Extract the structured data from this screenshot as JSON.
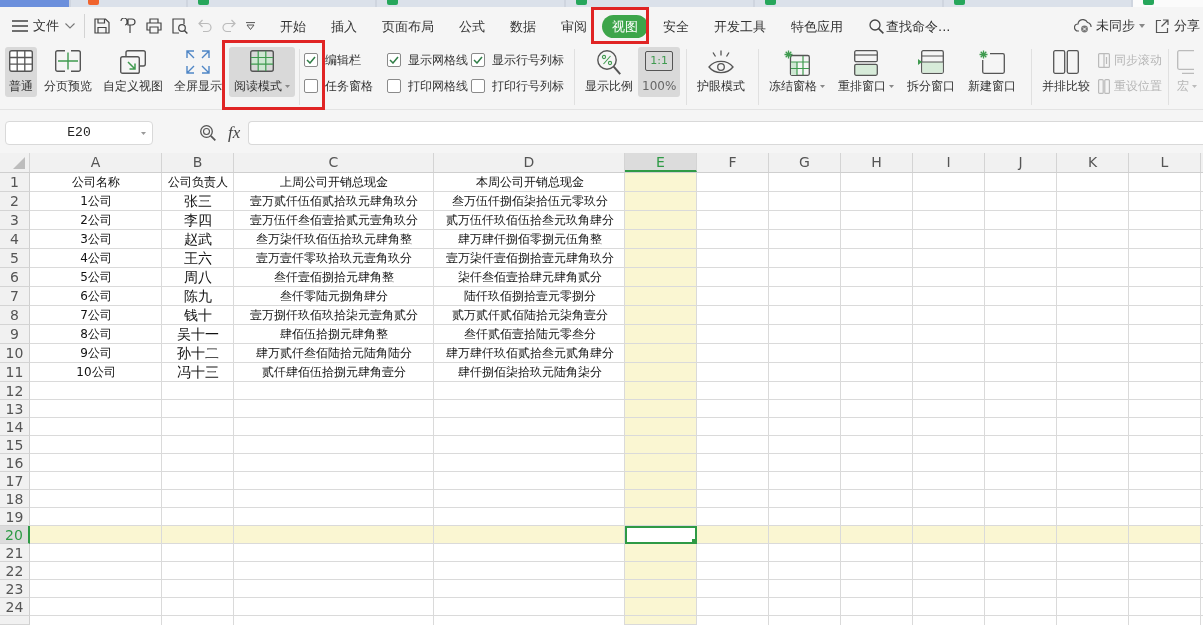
{
  "document_tabs": [
    {
      "selected": false,
      "color": "#f0642d"
    },
    {
      "selected": false,
      "color": "#26a65b"
    },
    {
      "selected": false,
      "color": "#26a65b"
    },
    {
      "selected": false,
      "color": "#26a65b"
    },
    {
      "selected": false,
      "color": "#26a65b"
    },
    {
      "selected": false,
      "color": "#26a65b"
    },
    {
      "selected": true,
      "color": "#26a65b"
    }
  ],
  "file_menu": {
    "label": "文件"
  },
  "menu_tabs": [
    {
      "label": "开始",
      "selected": false
    },
    {
      "label": "插入",
      "selected": false
    },
    {
      "label": "页面布局",
      "selected": false
    },
    {
      "label": "公式",
      "selected": false
    },
    {
      "label": "数据",
      "selected": false
    },
    {
      "label": "审阅",
      "selected": false
    },
    {
      "label": "视图",
      "selected": true
    },
    {
      "label": "安全",
      "selected": false
    },
    {
      "label": "开发工具",
      "selected": false
    },
    {
      "label": "特色应用",
      "selected": false
    }
  ],
  "command_search": {
    "placeholder": "查找命令..."
  },
  "sync_status": {
    "label": "未同步"
  },
  "share_button": {
    "label": "分享"
  },
  "ribbon": {
    "views": [
      {
        "label": "普通",
        "selected": true
      },
      {
        "label": "分页预览",
        "selected": false
      },
      {
        "label": "自定义视图",
        "selected": false
      },
      {
        "label": "全屏显示",
        "selected": false
      }
    ],
    "reading_mode": {
      "label": "阅读模式",
      "selected": true
    },
    "display_options": [
      {
        "label": "编辑栏",
        "checked": true
      },
      {
        "label": "任务窗格",
        "checked": false
      },
      {
        "label": "显示网格线",
        "checked": true
      },
      {
        "label": "打印网格线",
        "checked": false
      },
      {
        "label": "显示行号列标",
        "checked": true
      },
      {
        "label": "打印行号列标",
        "checked": false
      }
    ],
    "zoom": {
      "label": "显示比例"
    },
    "actual_size": {
      "label": "100%",
      "icon_text": "1:1",
      "selected": true
    },
    "eye_protection": {
      "label": "护眼模式"
    },
    "window_tools": [
      {
        "label": "冻结窗格",
        "dropdown": true
      },
      {
        "label": "重排窗口",
        "dropdown": true
      },
      {
        "label": "拆分窗口",
        "dropdown": false
      },
      {
        "label": "新建窗口",
        "dropdown": false
      }
    ],
    "compare": {
      "label": "并排比较"
    },
    "scroll_tools": [
      {
        "label": "同步滚动",
        "disabled": true
      },
      {
        "label": "重设位置",
        "disabled": true
      }
    ],
    "macro": {
      "label": "宏",
      "disabled": true,
      "dropdown": true
    }
  },
  "formula_bar": {
    "cell_ref": "E20",
    "function_label": "fx"
  },
  "sheet": {
    "columns": [
      {
        "label": "A",
        "selected": false
      },
      {
        "label": "B",
        "selected": false
      },
      {
        "label": "C",
        "selected": false
      },
      {
        "label": "D",
        "selected": false
      },
      {
        "label": "E",
        "selected": true
      },
      {
        "label": "F",
        "selected": false
      },
      {
        "label": "G",
        "selected": false
      },
      {
        "label": "H",
        "selected": false
      },
      {
        "label": "I",
        "selected": false
      },
      {
        "label": "J",
        "selected": false
      },
      {
        "label": "K",
        "selected": false
      },
      {
        "label": "L",
        "selected": false
      }
    ],
    "rows": [
      {
        "number": "1",
        "selected": false,
        "cells": [
          "公司名称",
          "公司负责人",
          "上周公司开销总现金",
          "本周公司开销总现金"
        ]
      },
      {
        "number": "2",
        "selected": false,
        "cells": [
          "1公司",
          "张三",
          "壹万贰仟伍佰贰拾玖元肆角玖分",
          "叁万伍仟捌佰柒拾伍元零玖分"
        ]
      },
      {
        "number": "3",
        "selected": false,
        "cells": [
          "2公司",
          "李四",
          "壹万伍仟叁佰壹拾贰元壹角玖分",
          "贰万伍仟玖佰伍拾叁元玖角肆分"
        ]
      },
      {
        "number": "4",
        "selected": false,
        "cells": [
          "3公司",
          "赵武",
          "叁万柒仟玖佰伍拾玖元肆角整",
          "肆万肆仟捌佰零捌元伍角整"
        ]
      },
      {
        "number": "5",
        "selected": false,
        "cells": [
          "4公司",
          "王六",
          "壹万壹仟零玖拾玖元壹角玖分",
          "壹万柒仟壹佰捌拾壹元肆角玖分"
        ]
      },
      {
        "number": "6",
        "selected": false,
        "cells": [
          "5公司",
          "周八",
          "叁仟壹佰捌拾元肆角整",
          "柒仟叁佰壹拾肆元肆角贰分"
        ]
      },
      {
        "number": "7",
        "selected": false,
        "cells": [
          "6公司",
          "陈九",
          "叁仟零陆元捌角肆分",
          "陆仟玖佰捌拾壹元零捌分"
        ]
      },
      {
        "number": "8",
        "selected": false,
        "cells": [
          "7公司",
          "钱十",
          "壹万捌仟玖佰玖拾柒元壹角贰分",
          "贰万贰仟贰佰陆拾元柒角壹分"
        ]
      },
      {
        "number": "9",
        "selected": false,
        "cells": [
          "8公司",
          "吴十一",
          "肆佰伍拾捌元肆角整",
          "叁仟贰佰壹拾陆元零叁分"
        ]
      },
      {
        "number": "10",
        "selected": false,
        "cells": [
          "9公司",
          "孙十二",
          "肆万贰仟叁佰陆拾元陆角陆分",
          "肆万肆仟玖佰贰拾叁元贰角肆分"
        ]
      },
      {
        "number": "11",
        "selected": false,
        "cells": [
          "10公司",
          "冯十三",
          "贰仟肆佰伍拾捌元肆角壹分",
          "肆仟捌佰柒拾玖元陆角柒分"
        ]
      },
      {
        "number": "12",
        "selected": false
      },
      {
        "number": "13",
        "selected": false
      },
      {
        "number": "14",
        "selected": false
      },
      {
        "number": "15",
        "selected": false
      },
      {
        "number": "16",
        "selected": false
      },
      {
        "number": "17",
        "selected": false
      },
      {
        "number": "18",
        "selected": false
      },
      {
        "number": "19",
        "selected": false
      },
      {
        "number": "20",
        "selected": true
      },
      {
        "number": "21",
        "selected": false
      },
      {
        "number": "22",
        "selected": false
      },
      {
        "number": "23",
        "selected": false
      },
      {
        "number": "24",
        "selected": false
      }
    ]
  }
}
